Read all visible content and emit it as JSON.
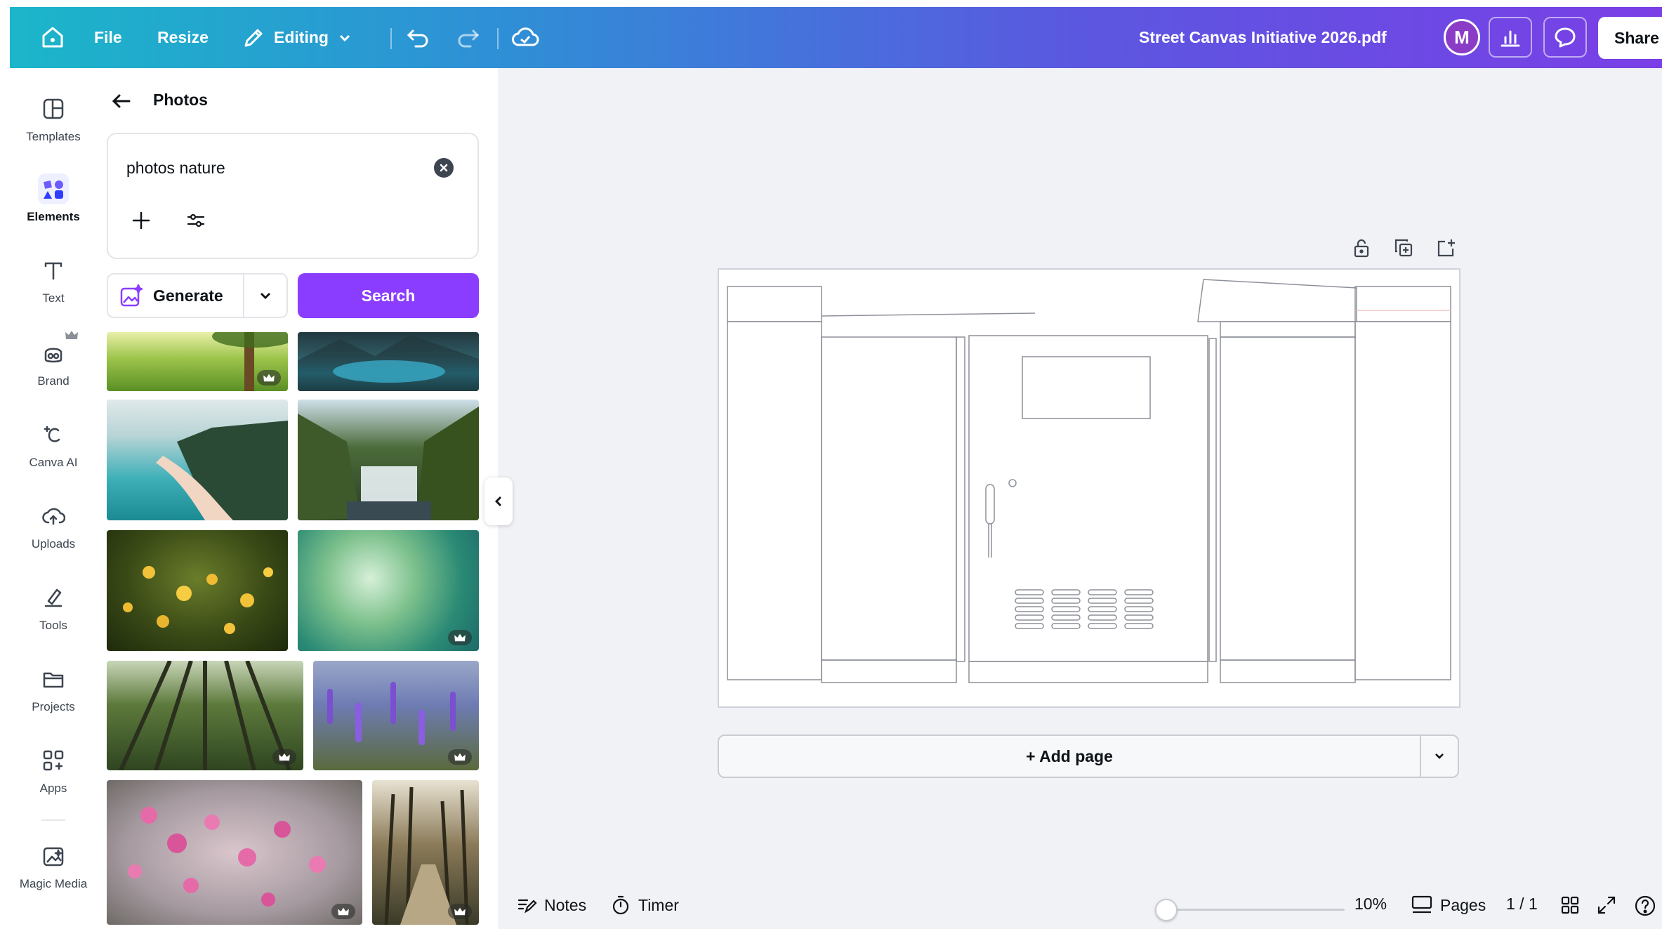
{
  "topbar": {
    "file_label": "File",
    "resize_label": "Resize",
    "editing_label": "Editing",
    "document_title": "Street Canvas Initiative 2026.pdf",
    "avatar_initial": "M",
    "share_label": "Share",
    "gradient_colors": [
      "#1bb6c9",
      "#5b57e0",
      "#7a3fe6"
    ]
  },
  "rail": {
    "items": [
      {
        "label": "Templates",
        "icon": "templates-icon"
      },
      {
        "label": "Elements",
        "icon": "elements-icon",
        "active": true
      },
      {
        "label": "Text",
        "icon": "text-icon"
      },
      {
        "label": "Brand",
        "icon": "brand-icon"
      },
      {
        "label": "Canva AI",
        "icon": "canva-ai-icon"
      },
      {
        "label": "Uploads",
        "icon": "uploads-icon"
      },
      {
        "label": "Tools",
        "icon": "tools-icon"
      },
      {
        "label": "Projects",
        "icon": "projects-icon"
      },
      {
        "label": "Apps",
        "icon": "apps-icon"
      },
      {
        "label": "Magic Media",
        "icon": "magic-media-icon"
      }
    ]
  },
  "panel": {
    "title": "Photos",
    "search_value": "photos nature",
    "generate_label": "Generate",
    "search_button_label": "Search",
    "accent_color": "#8b3dff",
    "photos": [
      {
        "subject": "meadow with tree",
        "premium": true
      },
      {
        "subject": "mountain lake",
        "premium": false
      },
      {
        "subject": "beach coastline",
        "premium": false
      },
      {
        "subject": "waterfall",
        "premium": false
      },
      {
        "subject": "yellow flowers",
        "premium": false
      },
      {
        "subject": "green bokeh",
        "premium": true
      },
      {
        "subject": "forest canopy",
        "premium": true
      },
      {
        "subject": "lavender field",
        "premium": true
      },
      {
        "subject": "pink blossoms",
        "premium": true
      },
      {
        "subject": "forest path",
        "premium": true
      }
    ]
  },
  "canvas": {
    "add_page_label": "+ Add page"
  },
  "footer": {
    "notes_label": "Notes",
    "timer_label": "Timer",
    "zoom_label": "10%",
    "zoom_fraction": 0.1,
    "pages_label": "Pages",
    "page_count": "1 / 1"
  }
}
